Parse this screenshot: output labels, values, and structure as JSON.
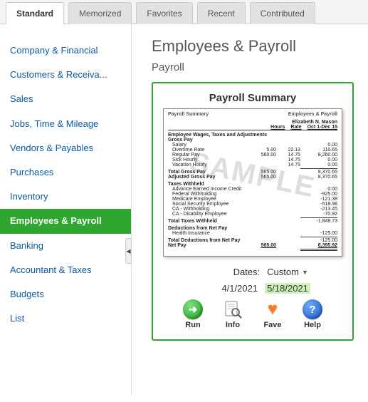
{
  "tabs": {
    "t0": "Standard",
    "t1": "Memorized",
    "t2": "Favorites",
    "t3": "Recent",
    "t4": "Contributed"
  },
  "sidebar": {
    "i0": "Company & Financial",
    "i1": "Customers & Receiva...",
    "i2": "Sales",
    "i3": "Jobs, Time & Mileage",
    "i4": "Vendors & Payables",
    "i5": "Purchases",
    "i6": "Inventory",
    "i7": "Employees & Payroll",
    "i8": "Banking",
    "i9": "Accountant & Taxes",
    "i10": "Budgets",
    "i11": "List"
  },
  "main": {
    "title": "Employees & Payroll",
    "subtitle": "Payroll",
    "report_title": "Payroll Summary"
  },
  "sample": {
    "hdr_left": "Payroll Summary",
    "hdr_right": "Employees & Payroll",
    "employee": "Elizabeth N. Mason",
    "col_hours": "Hours",
    "col_rate": "Rate",
    "col_period": "Oct 1-Dec 15",
    "sec_wages": "Employee Wages, Taxes and Adjustments",
    "gross_pay": "Gross Pay",
    "salary": "Salary",
    "salary_a": "0.00",
    "ot": "Overtime Rate",
    "ot_h": "5.00",
    "ot_r": "22.13",
    "ot_a": "110.65",
    "reg": "Regular Pay",
    "reg_h": "560.00",
    "reg_r": "14.75",
    "reg_a": "8,260.00",
    "sick": "Sick Hourly",
    "sick_r": "14.75",
    "sick_a": "0.00",
    "vac": "Vacation Hourly",
    "vac_r": "14.75",
    "vac_a": "0.00",
    "tgp": "Total Gross Pay",
    "tgp_h": "565.00",
    "tgp_a": "8,370.65",
    "agp": "Adjusted Gross Pay",
    "agp_h": "565.00",
    "agp_a": "8,370.65",
    "sec_taxes": "Taxes Withheld",
    "aeic": "Advance Earned Income Credit",
    "aeic_a": "0.00",
    "fed": "Federal Withholding",
    "fed_a": "-925.00",
    "med": "Medicare Employee",
    "med_a": "-121.38",
    "ss": "Social Security Employee",
    "ss_a": "-518.98",
    "ca": "CA - Withholding",
    "ca_a": "-213.45",
    "cad": "CA - Disability Employee",
    "cad_a": "-70.92",
    "ttw": "Total Taxes Withheld",
    "ttw_a": "-1,849.73",
    "sec_ded": "Deductions from Net Pay",
    "hi": "Health Insurance",
    "hi_a": "-125.00",
    "tdnp": "Total Deductions from Net Pay",
    "tdnp_a": "-125.00",
    "net": "Net Pay",
    "net_h": "565.00",
    "net_a": "6,395.92",
    "watermark": "SAMPLE"
  },
  "controls": {
    "dates_label": "Dates:",
    "range": "Custom",
    "from": "4/1/2021",
    "to": "5/18/2021",
    "run": "Run",
    "info": "Info",
    "fave": "Fave",
    "help": "Help"
  }
}
